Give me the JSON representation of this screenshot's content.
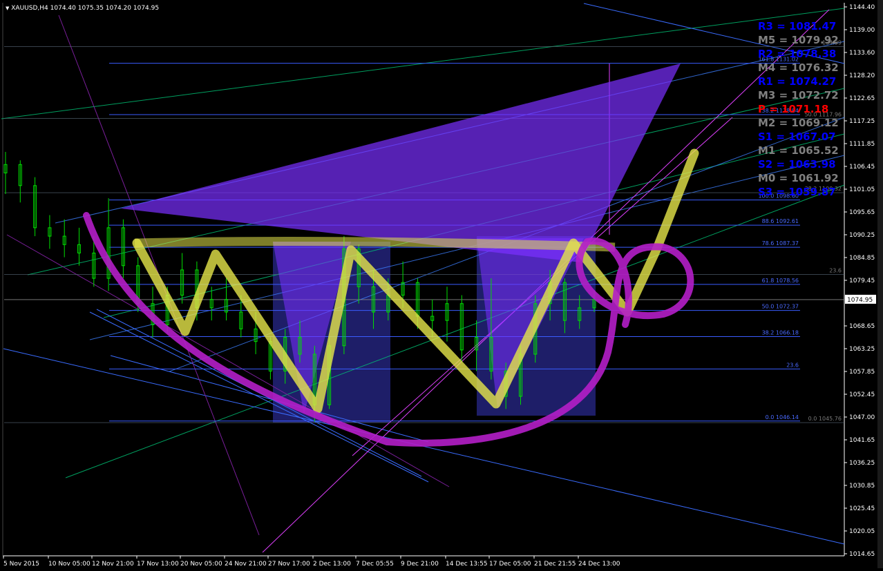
{
  "header": {
    "symbol": "XAUUSD,H4",
    "ohlc": "1074.40 1075.35 1074.20 1074.95"
  },
  "colors": {
    "background": "#000000",
    "price_axis": "#ffffff",
    "candles": "#00e000",
    "fib": "#3a5cff",
    "channel": "#00c878",
    "pattern_fill": "#7a2fff",
    "yellow_path": "#e6e64a",
    "magenta_path": "#b41ec8",
    "pivot_blue": "#0000ff",
    "pivot_gray": "#808080",
    "pivot_red": "#ff0000",
    "current_price_bg": "#ffffff"
  },
  "chart_data": {
    "type": "candlestick",
    "title": "",
    "symbol": "XAUUSD,H4",
    "ylim": [
      1014.65,
      1144.4
    ],
    "y_ticks": [
      "1144.40",
      "1139.00",
      "1133.60",
      "1128.20",
      "1122.65",
      "1117.25",
      "1111.85",
      "1106.45",
      "1101.05",
      "1095.65",
      "1090.25",
      "1084.85",
      "1079.45",
      "1074.95",
      "1068.65",
      "1063.25",
      "1057.85",
      "1052.45",
      "1047.00",
      "1041.65",
      "1036.25",
      "1030.85",
      "1025.45",
      "1020.05",
      "1014.65"
    ],
    "current_price": "1074.95",
    "x_ticks": [
      "5 Nov 2015",
      "10 Nov 05:00",
      "12 Nov 21:00",
      "17 Nov 13:00",
      "20 Nov 05:00",
      "24 Nov 21:00",
      "27 Nov 17:00",
      "2 Dec 13:00",
      "7 Dec 05:55",
      "9 Dec 21:00",
      "14 Dec 13:55",
      "17 Dec 05:00",
      "21 Dec 21:55",
      "24 Dec 13:00"
    ],
    "pivots": [
      {
        "label": "R3 = 1081.47",
        "level": "R3",
        "color": "blue"
      },
      {
        "label": "M5 = 1079.92",
        "level": "M5",
        "color": "gray"
      },
      {
        "label": "R2 = 1078.38",
        "level": "R2",
        "color": "blue"
      },
      {
        "label": "M4 = 1076.32",
        "level": "M4",
        "color": "gray"
      },
      {
        "label": "R1 = 1074.27",
        "level": "R1",
        "color": "blue"
      },
      {
        "label": "M3 = 1072.72",
        "level": "M3",
        "color": "gray"
      },
      {
        "label": "P = 1071.18",
        "level": "P",
        "color": "red"
      },
      {
        "label": "M2 = 1069.12",
        "level": "M2",
        "color": "gray"
      },
      {
        "label": "S1 = 1067.07",
        "level": "S1",
        "color": "blue"
      },
      {
        "label": "M1 = 1065.52",
        "level": "M1",
        "color": "gray"
      },
      {
        "label": "S2 = 1063.98",
        "level": "S2",
        "color": "blue"
      },
      {
        "label": "M0 = 1061.92",
        "level": "M0",
        "color": "gray"
      },
      {
        "label": "S3 = 1059.87",
        "level": "S3",
        "color": "blue"
      }
    ],
    "fib_levels": [
      {
        "label": "161.8 1131.02",
        "price": 1131.02
      },
      {
        "label": "138.2 1118.84",
        "price": 1118.84
      },
      {
        "label": "100.0 1098.60",
        "price": 1098.6
      },
      {
        "label": "88.6 1092.61",
        "price": 1092.61
      },
      {
        "label": "78.6 1087.37",
        "price": 1087.37
      },
      {
        "label": "61.8 1078.56",
        "price": 1078.56
      },
      {
        "label": "50.0 1072.37",
        "price": 1072.37
      },
      {
        "label": "38.2 1066.18",
        "price": 1066.18
      },
      {
        "label": "23.6",
        "price": 1058.5
      },
      {
        "label": "0.0 1046.14",
        "price": 1046.14
      }
    ],
    "extra_labels": [
      {
        "label": "134.99",
        "price": 1134.99
      },
      {
        "label": "50.0 1117.96",
        "price": 1117.96
      },
      {
        "label": "38.2 1100.32",
        "price": 1100.32
      },
      {
        "label": "23.6",
        "price": 1080.9
      },
      {
        "label": "0.0 1045.76",
        "price": 1045.76
      }
    ],
    "candles": [
      {
        "x": "5 Nov 2015",
        "o": 1105,
        "h": 1110,
        "l": 1100,
        "c": 1107
      },
      {
        "x": "",
        "o": 1107,
        "h": 1108,
        "l": 1098,
        "c": 1102
      },
      {
        "x": "",
        "o": 1102,
        "h": 1104,
        "l": 1090,
        "c": 1092
      },
      {
        "x": "",
        "o": 1092,
        "h": 1095,
        "l": 1087,
        "c": 1090
      },
      {
        "x": "10 Nov 05:00",
        "o": 1090,
        "h": 1094,
        "l": 1085,
        "c": 1088
      },
      {
        "x": "",
        "o": 1088,
        "h": 1092,
        "l": 1083,
        "c": 1086
      },
      {
        "x": "",
        "o": 1086,
        "h": 1090,
        "l": 1078,
        "c": 1080
      },
      {
        "x": "12 Nov 21:00",
        "o": 1080,
        "h": 1099,
        "l": 1077,
        "c": 1092
      },
      {
        "x": "",
        "o": 1092,
        "h": 1094,
        "l": 1080,
        "c": 1083
      },
      {
        "x": "",
        "o": 1083,
        "h": 1085,
        "l": 1072,
        "c": 1074
      },
      {
        "x": "17 Nov 13:00",
        "o": 1074,
        "h": 1078,
        "l": 1066,
        "c": 1069
      },
      {
        "x": "",
        "o": 1069,
        "h": 1078,
        "l": 1067,
        "c": 1076
      },
      {
        "x": "",
        "o": 1076,
        "h": 1086,
        "l": 1074,
        "c": 1082
      },
      {
        "x": "20 Nov 05:00",
        "o": 1082,
        "h": 1084,
        "l": 1070,
        "c": 1073
      },
      {
        "x": "",
        "o": 1073,
        "h": 1078,
        "l": 1070,
        "c": 1075
      },
      {
        "x": "",
        "o": 1075,
        "h": 1080,
        "l": 1070,
        "c": 1072
      },
      {
        "x": "24 Nov 21:00",
        "o": 1072,
        "h": 1076,
        "l": 1066,
        "c": 1068
      },
      {
        "x": "",
        "o": 1068,
        "h": 1072,
        "l": 1062,
        "c": 1065
      },
      {
        "x": "",
        "o": 1065,
        "h": 1066,
        "l": 1056,
        "c": 1058
      },
      {
        "x": "27 Nov 17:00",
        "o": 1058,
        "h": 1068,
        "l": 1055,
        "c": 1066
      },
      {
        "x": "",
        "o": 1066,
        "h": 1070,
        "l": 1060,
        "c": 1062
      },
      {
        "x": "",
        "o": 1062,
        "h": 1064,
        "l": 1046,
        "c": 1050
      },
      {
        "x": "2 Dec 13:00",
        "o": 1050,
        "h": 1066,
        "l": 1049,
        "c": 1064
      },
      {
        "x": "",
        "o": 1064,
        "h": 1090,
        "l": 1062,
        "c": 1087
      },
      {
        "x": "",
        "o": 1087,
        "h": 1088,
        "l": 1074,
        "c": 1078
      },
      {
        "x": "7 Dec 05:55",
        "o": 1078,
        "h": 1082,
        "l": 1068,
        "c": 1072
      },
      {
        "x": "",
        "o": 1072,
        "h": 1080,
        "l": 1070,
        "c": 1076
      },
      {
        "x": "",
        "o": 1076,
        "h": 1084,
        "l": 1073,
        "c": 1079
      },
      {
        "x": "9 Dec 21:00",
        "o": 1079,
        "h": 1080,
        "l": 1068,
        "c": 1071
      },
      {
        "x": "",
        "o": 1071,
        "h": 1075,
        "l": 1066,
        "c": 1070
      },
      {
        "x": "",
        "o": 1070,
        "h": 1078,
        "l": 1065,
        "c": 1074
      },
      {
        "x": "14 Dec 13:55",
        "o": 1074,
        "h": 1076,
        "l": 1060,
        "c": 1063
      },
      {
        "x": "",
        "o": 1063,
        "h": 1070,
        "l": 1058,
        "c": 1066
      },
      {
        "x": "",
        "o": 1066,
        "h": 1080,
        "l": 1056,
        "c": 1058
      },
      {
        "x": "17 Dec 05:00",
        "o": 1058,
        "h": 1060,
        "l": 1049,
        "c": 1052
      },
      {
        "x": "",
        "o": 1052,
        "h": 1064,
        "l": 1050,
        "c": 1062
      },
      {
        "x": "",
        "o": 1062,
        "h": 1076,
        "l": 1060,
        "c": 1074
      },
      {
        "x": "21 Dec 21:55",
        "o": 1074,
        "h": 1082,
        "l": 1070,
        "c": 1079
      },
      {
        "x": "",
        "o": 1079,
        "h": 1080,
        "l": 1067,
        "c": 1070
      },
      {
        "x": "",
        "o": 1070,
        "h": 1076,
        "l": 1068,
        "c": 1073
      },
      {
        "x": "24 Dec 13:00",
        "o": 1073,
        "h": 1077,
        "l": 1072,
        "c": 1075
      }
    ]
  }
}
